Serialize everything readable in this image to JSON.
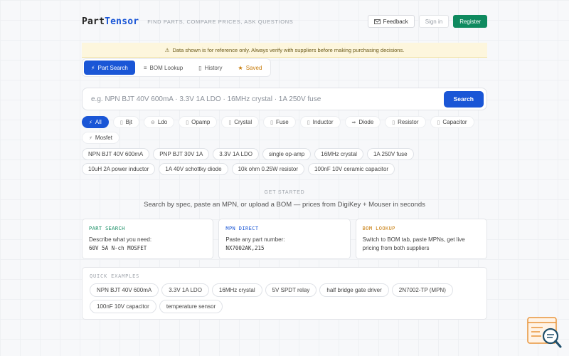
{
  "header": {
    "logo_part1": "Part",
    "logo_part2": "Tensor",
    "tagline": "FIND PARTS, COMPARE PRICES, ASK QUESTIONS",
    "feedback_label": "Feedback",
    "signin_label": "Sign in",
    "register_label": "Register"
  },
  "notice": {
    "icon": "⚠",
    "text": "Data shown is for reference only. Always verify with suppliers before making purchasing decisions."
  },
  "tabs": [
    {
      "icon": "⚡",
      "label": "Part Search"
    },
    {
      "icon": "≡",
      "label": "BOM Lookup"
    },
    {
      "icon": "▯",
      "label": "History"
    },
    {
      "icon": "★",
      "label": "Saved"
    }
  ],
  "search": {
    "placeholder": "e.g. NPN BJT 40V 600mA · 3.3V 1A LDO · 16MHz crystal · 1A 250V fuse",
    "button_label": "Search"
  },
  "categories": [
    {
      "icon": "⚡",
      "label": "All"
    },
    {
      "icon": "▯",
      "label": "Bjt"
    },
    {
      "icon": "⊖",
      "label": "Ldo"
    },
    {
      "icon": "▯",
      "label": "Opamp"
    },
    {
      "icon": "▯",
      "label": "Crystal"
    },
    {
      "icon": "▯",
      "label": "Fuse"
    },
    {
      "icon": "▯",
      "label": "Inductor"
    },
    {
      "icon": "➡",
      "label": "Diode"
    },
    {
      "icon": "▯",
      "label": "Resistor"
    },
    {
      "icon": "▯",
      "label": "Capacitor"
    },
    {
      "icon": "⚡",
      "label": "Mosfet"
    }
  ],
  "suggestions": [
    "NPN BJT 40V 600mA",
    "PNP BJT 30V 1A",
    "3.3V 1A LDO",
    "single op-amp",
    "16MHz crystal",
    "1A 250V fuse",
    "10uH 2A power inductor",
    "1A 40V schottky diode",
    "10k ohm 0.25W resistor",
    "100nF 10V ceramic capacitor"
  ],
  "get_started": {
    "label": "GET STARTED",
    "subtitle": "Search by spec, paste an MPN, or upload a BOM — prices from DigiKey + Mouser in seconds"
  },
  "cards": [
    {
      "title": "PART SEARCH",
      "desc": "Describe what you need:",
      "code": "60V 5A N-ch MOSFET"
    },
    {
      "title": "MPN DIRECT",
      "desc": "Paste any part number:",
      "code": "NX7002AK,215"
    },
    {
      "title": "BOM LOOKUP",
      "desc": "Switch to BOM tab, paste MPNs, get live pricing from both suppliers",
      "code": ""
    }
  ],
  "quick_examples": {
    "title": "QUICK EXAMPLES",
    "items": [
      "NPN BJT 40V 600mA",
      "3.3V 1A LDO",
      "16MHz crystal",
      "5V SPDT relay",
      "half bridge gate driver",
      "2N7002-TP (MPN)",
      "100nF 10V capacitor",
      "temperature sensor"
    ]
  },
  "colors": {
    "primary": "#1a56d6",
    "register": "#0f8a5f",
    "saved": "#c77b0a",
    "notice_bg": "#fdf6dd"
  }
}
